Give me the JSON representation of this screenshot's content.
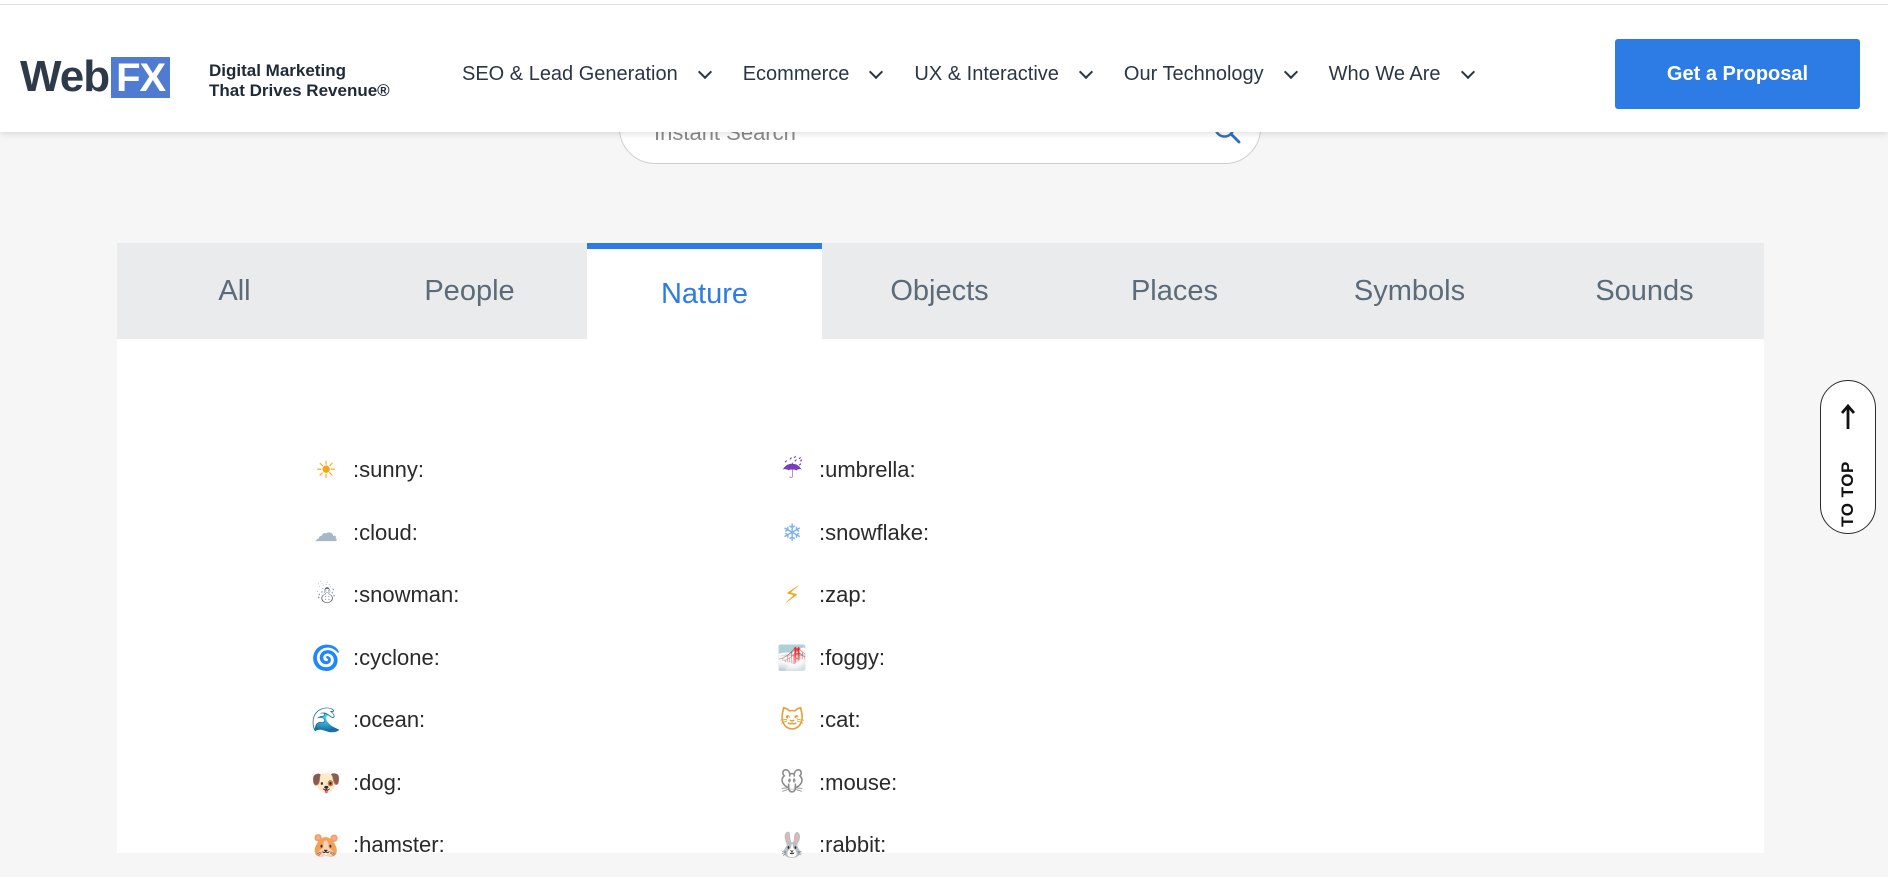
{
  "header": {
    "logo_web": "Web",
    "logo_fx": "FX",
    "tagline_line1": "Digital Marketing",
    "tagline_line2": "That Drives Revenue®",
    "nav": [
      {
        "label": "SEO & Lead Generation"
      },
      {
        "label": "Ecommerce"
      },
      {
        "label": "UX & Interactive"
      },
      {
        "label": "Our Technology"
      },
      {
        "label": "Who We Are"
      }
    ],
    "cta_label": "Get a Proposal"
  },
  "search": {
    "placeholder": "Instant Search",
    "value": ""
  },
  "tabs": [
    {
      "label": "All"
    },
    {
      "label": "People"
    },
    {
      "label": "Nature",
      "active": true
    },
    {
      "label": "Objects"
    },
    {
      "label": "Places"
    },
    {
      "label": "Symbols"
    },
    {
      "label": "Sounds"
    }
  ],
  "emojis": {
    "left": [
      {
        "glyph": "☀",
        "code": ":sunny:"
      },
      {
        "glyph": "☁",
        "code": ":cloud:"
      },
      {
        "glyph": "☃",
        "code": ":snowman:"
      },
      {
        "glyph": "🌀",
        "code": ":cyclone:"
      },
      {
        "glyph": "🌊",
        "code": ":ocean:"
      },
      {
        "glyph": "🐶",
        "code": ":dog:"
      },
      {
        "glyph": "🐹",
        "code": ":hamster:"
      }
    ],
    "right": [
      {
        "glyph": "☔",
        "code": ":umbrella:"
      },
      {
        "glyph": "❄",
        "code": ":snowflake:"
      },
      {
        "glyph": "⚡",
        "code": ":zap:"
      },
      {
        "glyph": "🌁",
        "code": ":foggy:"
      },
      {
        "glyph": "🐱",
        "code": ":cat:"
      },
      {
        "glyph": "🐭",
        "code": ":mouse:"
      },
      {
        "glyph": "🐰",
        "code": ":rabbit:"
      }
    ]
  },
  "to_top_label": "TO TOP",
  "colors": {
    "accent": "#2d7be5",
    "logo_fx_bg": "#4f7bd1",
    "tab_bar_bg": "#e9ebec",
    "page_bg": "#f6f6f6"
  },
  "icons": {
    "search": "search-icon",
    "nav_chevron": "chevron-down-icon",
    "to_top_arrow": "arrow-up-icon"
  }
}
